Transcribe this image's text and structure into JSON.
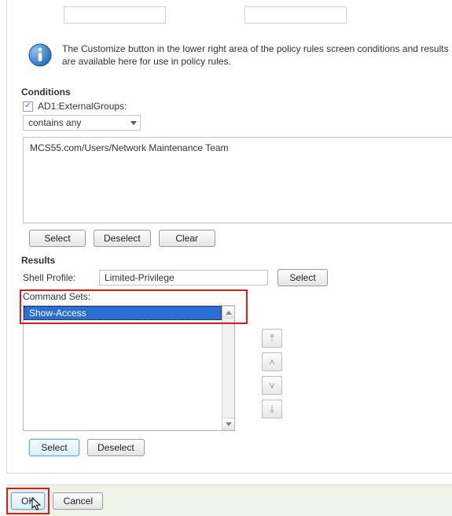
{
  "info_text": "The Customize button in the lower right area of the policy rules screen conditions and results are available here for use in policy rules.",
  "conditions": {
    "title": "Conditions",
    "checkbox_label": "AD1:ExternalGroups:",
    "operator": "contains any",
    "value": "MCS55.com/Users/Network Maintenance Team",
    "buttons": {
      "select": "Select",
      "deselect": "Deselect",
      "clear": "Clear"
    }
  },
  "results": {
    "title": "Results",
    "shell_profile_label": "Shell Profile:",
    "shell_profile_value": "Limited-Privilege",
    "shell_profile_select": "Select",
    "command_sets_label": "Command Sets:",
    "command_sets_items": [
      "Show-Access"
    ],
    "buttons": {
      "select": "Select",
      "deselect": "Deselect"
    }
  },
  "footer": {
    "ok": "OK",
    "cancel": "Cancel"
  },
  "icons": {
    "move_top": "⤒",
    "move_up": "˄",
    "move_down": "˅",
    "move_bottom": "⤓"
  }
}
